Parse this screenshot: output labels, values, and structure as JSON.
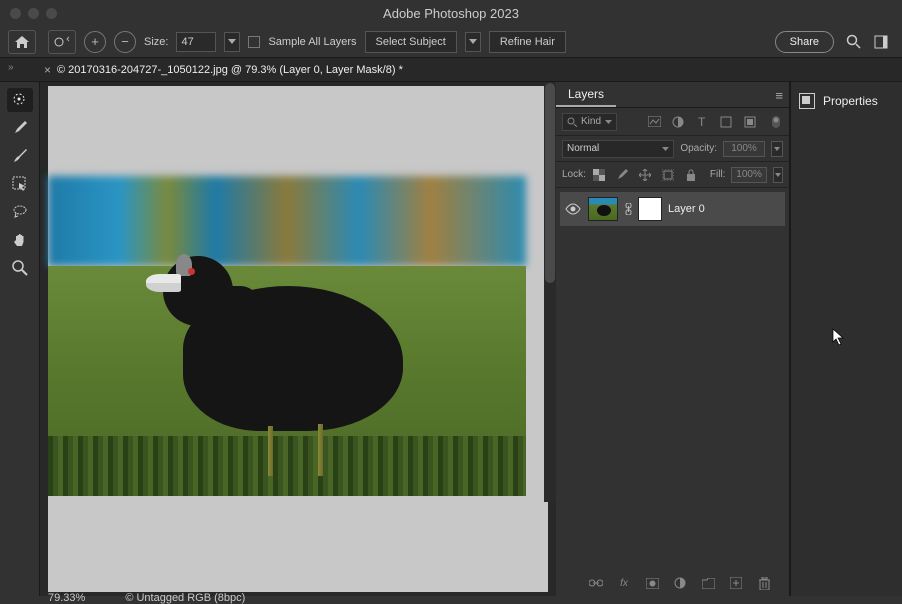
{
  "app": {
    "title": "Adobe Photoshop 2023"
  },
  "options": {
    "size_label": "Size:",
    "size_value": "47",
    "sample_all_label": "Sample All Layers",
    "select_subject_label": "Select Subject",
    "refine_hair_label": "Refine Hair",
    "share_label": "Share"
  },
  "document": {
    "tab_title": "© 20170316-204727-_1050122.jpg @ 79.3% (Layer 0, Layer Mask/8) *",
    "zoom": "79.33%",
    "color_profile": "© Untagged RGB (8bpc)"
  },
  "panels": {
    "layers": {
      "tab": "Layers",
      "kind_label": "Kind",
      "blend_mode": "Normal",
      "opacity_label": "Opacity:",
      "opacity_value": "100%",
      "lock_label": "Lock:",
      "fill_label": "Fill:",
      "fill_value": "100%",
      "layers_list": [
        {
          "name": "Layer 0"
        }
      ]
    },
    "properties": {
      "tab": "Properties"
    }
  }
}
